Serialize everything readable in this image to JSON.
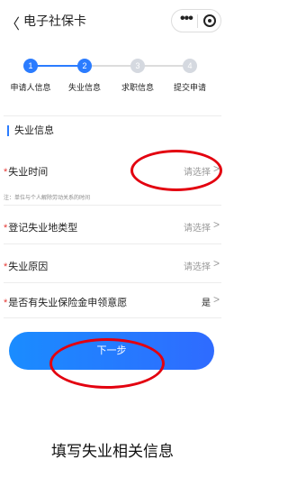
{
  "header": {
    "back_glyph": "〈",
    "title": "电子社保卡",
    "more_glyph": "•••"
  },
  "steps": [
    {
      "number": "1",
      "label": "申请人信息",
      "state": "done"
    },
    {
      "number": "2",
      "label": "失业信息",
      "state": "active"
    },
    {
      "number": "3",
      "label": "求职信息",
      "state": "pending"
    },
    {
      "number": "4",
      "label": "提交申请",
      "state": "pending"
    }
  ],
  "section": {
    "title": "失业信息"
  },
  "form": {
    "required_mark": "*",
    "unemployment_time": {
      "label": "失业时间",
      "value": "请选择"
    },
    "note": "注：单位与个人解除劳动关系的时间",
    "registration_location_type": {
      "label": "登记失业地类型",
      "value": "请选择"
    },
    "unemployment_reason": {
      "label": "失业原因",
      "value": "请选择"
    },
    "insurance_willingness": {
      "label": "是否有失业保险金申领意愿",
      "value": "是"
    },
    "chevron": ">"
  },
  "next_button": {
    "label": "下一步"
  },
  "caption": "填写失业相关信息",
  "colors": {
    "accent": "#2b7cff",
    "required": "#e53935",
    "annotation": "#e3000f"
  }
}
